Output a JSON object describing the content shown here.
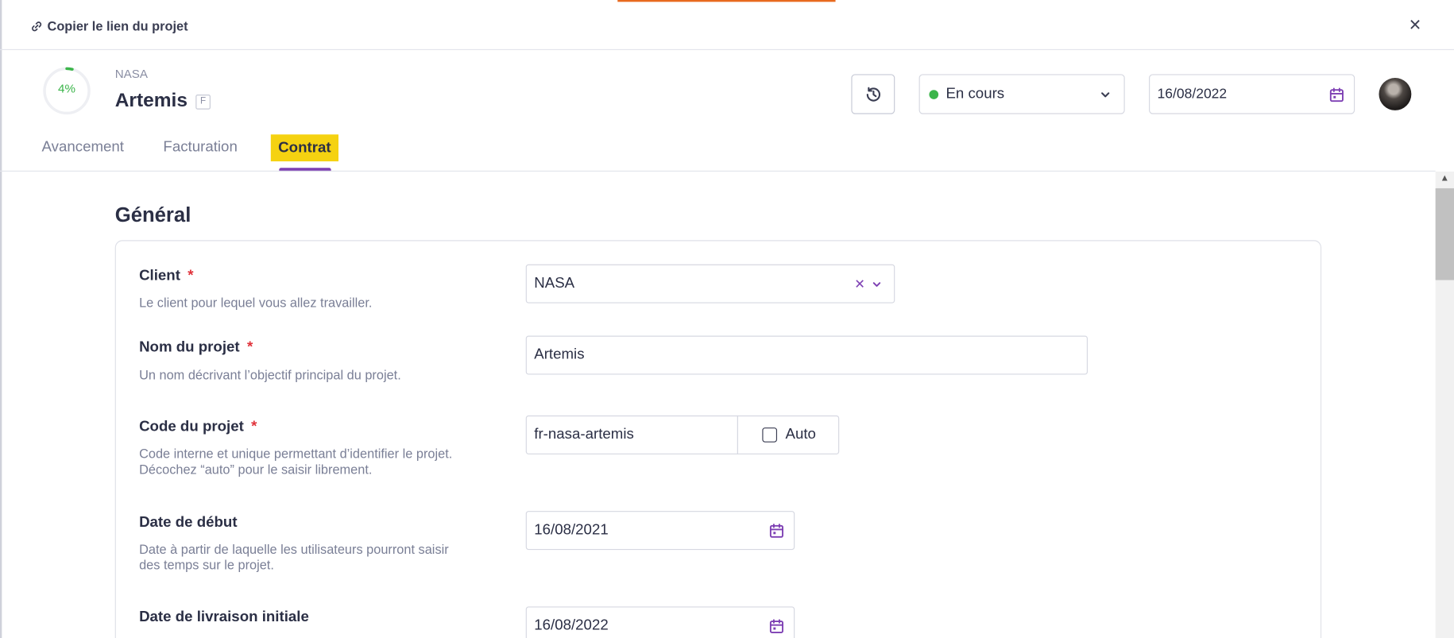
{
  "toolbar": {
    "copy_link_label": "Copier le lien du projet",
    "close_label": "×"
  },
  "header": {
    "progress_percent": 4,
    "progress_text": "4%",
    "client": "NASA",
    "project_name": "Artemis",
    "badge": "F",
    "status": {
      "label": "En cours",
      "color": "#3bb54a"
    },
    "date": "16/08/2022"
  },
  "tabs": [
    {
      "label": "Avancement",
      "active": false
    },
    {
      "label": "Facturation",
      "active": false
    },
    {
      "label": "Contrat",
      "active": true
    }
  ],
  "section": {
    "title": "Général",
    "fields": {
      "client": {
        "label": "Client",
        "required": "*",
        "help": "Le client pour lequel vous allez travailler.",
        "value": "NASA"
      },
      "project_name": {
        "label": "Nom du projet",
        "required": "*",
        "help": "Un nom décrivant l’objectif principal du projet.",
        "value": "Artemis"
      },
      "project_code": {
        "label": "Code du projet",
        "required": "*",
        "help_line1": "Code interne et unique permettant d’identifier le projet.",
        "help_line2": "Décochez “auto” pour le saisir librement.",
        "value": "fr-nasa-artemis",
        "auto_label": "Auto"
      },
      "start_date": {
        "label": "Date de début",
        "help_line1": "Date à partir de laquelle les utilisateurs pourront saisir",
        "help_line2": "des temps sur le projet.",
        "value": "16/08/2021"
      },
      "delivery_date": {
        "label": "Date de livraison initiale",
        "value": "16/08/2022"
      }
    }
  },
  "colors": {
    "accent": "#7d3fb3",
    "tab_highlight": "#f5d211",
    "progress": "#3bb54a",
    "required": "#e0323a"
  }
}
